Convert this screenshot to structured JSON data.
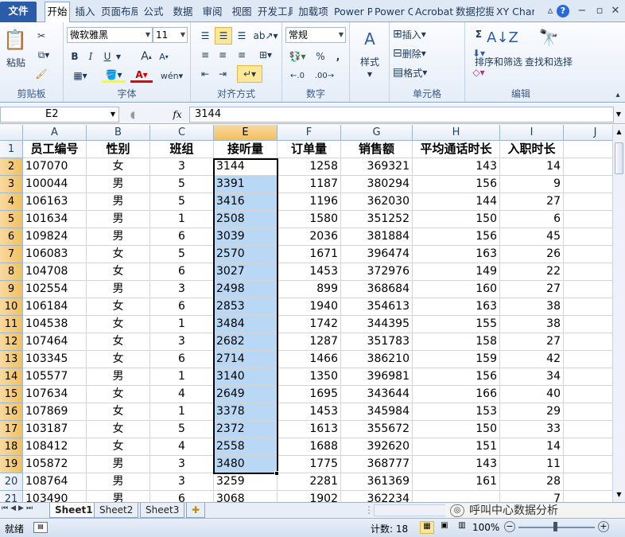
{
  "tabs": [
    "文件",
    "开始",
    "插入",
    "页面布局",
    "公式",
    "数据",
    "审阅",
    "视图",
    "开发工具",
    "加载项",
    "Power Pivot",
    "Power Query",
    "Acrobat",
    "数据挖掘",
    "XY Chart Labels"
  ],
  "ribbon": {
    "clipboard": {
      "paste": "粘贴",
      "label": "剪贴板"
    },
    "font": {
      "name": "微软雅黑",
      "size": "11",
      "label": "字体",
      "bold": "B",
      "italic": "I",
      "underline": "U"
    },
    "align": {
      "label": "对齐方式"
    },
    "number": {
      "format": "常规",
      "label": "数字",
      "percent": "%",
      "comma": ","
    },
    "style": {
      "label": "样式"
    },
    "cells": {
      "insert": "插入",
      "delete": "删除",
      "format": "格式",
      "label": "单元格"
    },
    "edit": {
      "sum": "Σ",
      "sort": "排序和筛选",
      "find": "查找和选择",
      "label": "编辑"
    }
  },
  "formula_bar": {
    "name_box": "E2",
    "fx": "fx",
    "value": "3144"
  },
  "columns": [
    "A",
    "B",
    "C",
    "E",
    "F",
    "G",
    "H",
    "I",
    "J"
  ],
  "header_row": [
    "员工编号",
    "性别",
    "班组",
    "接听量",
    "订单量",
    "销售额",
    "平均通话时长",
    "入职时长"
  ],
  "rows": [
    [
      "107070",
      "女",
      "3",
      "3144",
      "1258",
      "369321",
      "143",
      "14"
    ],
    [
      "100044",
      "男",
      "5",
      "3391",
      "1187",
      "380294",
      "156",
      "9"
    ],
    [
      "106163",
      "男",
      "5",
      "3416",
      "1196",
      "362030",
      "144",
      "27"
    ],
    [
      "101634",
      "男",
      "1",
      "2508",
      "1580",
      "351252",
      "150",
      "6"
    ],
    [
      "109824",
      "男",
      "6",
      "3039",
      "2036",
      "381884",
      "156",
      "45"
    ],
    [
      "106083",
      "女",
      "5",
      "2570",
      "1671",
      "396474",
      "163",
      "26"
    ],
    [
      "104708",
      "女",
      "6",
      "3027",
      "1453",
      "372976",
      "149",
      "22"
    ],
    [
      "102554",
      "男",
      "3",
      "2498",
      "899",
      "368684",
      "160",
      "27"
    ],
    [
      "106184",
      "女",
      "6",
      "2853",
      "1940",
      "354613",
      "163",
      "38"
    ],
    [
      "104538",
      "女",
      "1",
      "3484",
      "1742",
      "344395",
      "155",
      "38"
    ],
    [
      "107464",
      "女",
      "3",
      "2682",
      "1287",
      "351783",
      "158",
      "27"
    ],
    [
      "103345",
      "女",
      "6",
      "2714",
      "1466",
      "386210",
      "159",
      "42"
    ],
    [
      "105577",
      "男",
      "1",
      "3140",
      "1350",
      "396981",
      "156",
      "34"
    ],
    [
      "107634",
      "女",
      "4",
      "2649",
      "1695",
      "343644",
      "166",
      "40"
    ],
    [
      "107869",
      "女",
      "1",
      "3378",
      "1453",
      "345984",
      "153",
      "29"
    ],
    [
      "103187",
      "女",
      "5",
      "2372",
      "1613",
      "355672",
      "150",
      "33"
    ],
    [
      "108412",
      "女",
      "4",
      "2558",
      "1688",
      "392620",
      "151",
      "14"
    ],
    [
      "105872",
      "男",
      "3",
      "3480",
      "1775",
      "368777",
      "143",
      "11"
    ],
    [
      "108764",
      "男",
      "3",
      "3259",
      "2281",
      "361369",
      "161",
      "28"
    ],
    [
      "103490",
      "男",
      "6",
      "3068",
      "1902",
      "362234",
      "",
      "7"
    ]
  ],
  "row_numbers": [
    "1",
    "2",
    "3",
    "4",
    "5",
    "6",
    "7",
    "8",
    "9",
    "10",
    "11",
    "12",
    "13",
    "14",
    "15",
    "16",
    "17",
    "18",
    "19",
    "20",
    "21"
  ],
  "sheets": [
    "Sheet1",
    "Sheet2",
    "Sheet3"
  ],
  "status": {
    "ready": "就绪",
    "count": "计数: 18",
    "zoom": "100%"
  },
  "watermark": "呼叫中心数据分析",
  "colors": {
    "selection": "#b8d8f5",
    "header_sel": "#f1c15f",
    "file_tab": "#2a5caa"
  }
}
